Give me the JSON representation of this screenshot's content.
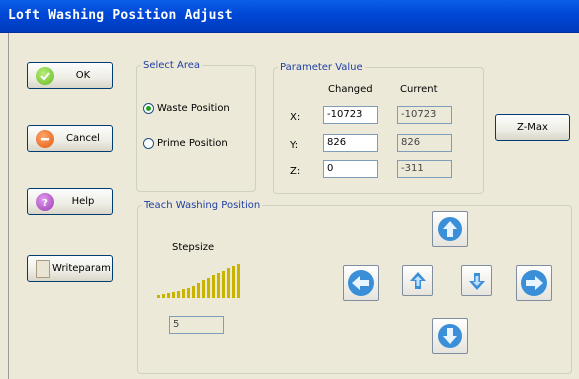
{
  "window": {
    "title": "Loft Washing Position Adjust"
  },
  "buttons": {
    "ok": "OK",
    "cancel": "Cancel",
    "help": "Help",
    "writeparam": "Writeparam",
    "zmax": "Z-Max"
  },
  "select_area": {
    "legend": "Select Area",
    "options": [
      {
        "label": "Waste Position",
        "selected": true
      },
      {
        "label": "Prime Position",
        "selected": false
      }
    ]
  },
  "parameters": {
    "legend": "Parameter Value",
    "changed_header": "Changed",
    "current_header": "Current",
    "rows": [
      {
        "axis": "X:",
        "changed": "-10723",
        "current": "-10723"
      },
      {
        "axis": "Y:",
        "changed": "826",
        "current": "826"
      },
      {
        "axis": "Z:",
        "changed": "0",
        "current": "-311"
      }
    ]
  },
  "teach": {
    "legend": "Teach Washing Position",
    "stepsize_label": "Stepsize",
    "stepsize_value": "5"
  },
  "colors": {
    "title_bar": "#0047d6",
    "ok_icon": "#66bb22",
    "cancel_icon": "#e05a10",
    "help_icon": "#9b3bb0",
    "arrow_blue": "#3a8fd8",
    "stepsize_bars": "#c8b400"
  },
  "icons": {
    "ok": "check-icon",
    "cancel": "minus-icon",
    "help": "question-icon",
    "writeparam": "document-icon",
    "up": "arrow-up-icon",
    "down": "arrow-down-icon",
    "left": "arrow-left-icon",
    "right": "arrow-right-icon",
    "z_up": "z-up-icon",
    "z_down": "z-down-icon"
  }
}
